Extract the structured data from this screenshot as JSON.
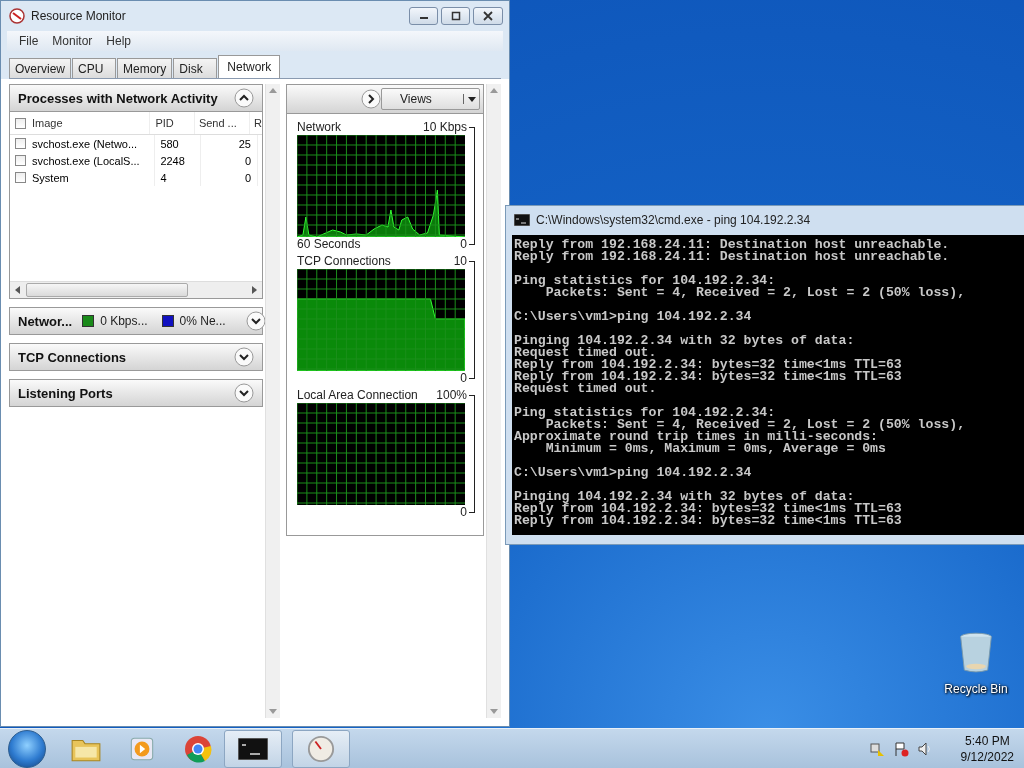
{
  "resource_monitor": {
    "title": "Resource Monitor",
    "menu": [
      "File",
      "Monitor",
      "Help"
    ],
    "tabs": [
      {
        "label": "Overview",
        "selected": false
      },
      {
        "label": "CPU",
        "selected": false
      },
      {
        "label": "Memory",
        "selected": false
      },
      {
        "label": "Disk",
        "selected": false
      },
      {
        "label": "Network",
        "selected": true
      }
    ],
    "processes_panel": {
      "title": "Processes with Network Activity",
      "expanded": true,
      "all_checked": false,
      "columns": [
        "Image",
        "PID",
        "Send ...",
        "R"
      ],
      "rows": [
        {
          "image": "svchost.exe (Netwo...",
          "pid": "580",
          "send": "25",
          "checked": false
        },
        {
          "image": "svchost.exe (LocalS...",
          "pid": "2248",
          "send": "0",
          "checked": false
        },
        {
          "image": "System",
          "pid": "4",
          "send": "0",
          "checked": false
        }
      ]
    },
    "collapsed_panels": [
      {
        "title": "Networ...",
        "expanded": false,
        "legend": [
          {
            "text": "0 Kbps...",
            "color": "#1a8a1a"
          },
          {
            "text": "0% Ne...",
            "color": "#1010c0"
          }
        ]
      },
      {
        "title": "TCP Connections",
        "expanded": false
      },
      {
        "title": "Listening Ports",
        "expanded": false
      }
    ],
    "graphs_panel": {
      "views_button": "Views",
      "graphs": [
        {
          "kind": "spiky",
          "title": "Network",
          "max": "10 Kbps",
          "footer": "60 Seconds",
          "min": "0"
        },
        {
          "kind": "filled",
          "title": "TCP Connections",
          "max": "10",
          "min": "0"
        },
        {
          "kind": "empty",
          "title": "Local Area Connection",
          "max": "100%",
          "min": "0"
        }
      ]
    }
  },
  "cmd": {
    "title": "C:\\Windows\\system32\\cmd.exe - ping  104.192.2.34",
    "blocks": [
      [
        "Reply from 192.168.24.11: Destination host unreachable.",
        "Reply from 192.168.24.11: Destination host unreachable."
      ],
      [
        "Ping statistics for 104.192.2.34:",
        "    Packets: Sent = 4, Received = 2, Lost = 2 (50% loss),"
      ],
      [
        "C:\\Users\\vm1>ping 104.192.2.34"
      ],
      [
        "Pinging 104.192.2.34 with 32 bytes of data:",
        "Request timed out.",
        "Reply from 104.192.2.34: bytes=32 time<1ms TTL=63",
        "Reply from 104.192.2.34: bytes=32 time<1ms TTL=63",
        "Request timed out."
      ],
      [
        "Ping statistics for 104.192.2.34:",
        "    Packets: Sent = 4, Received = 2, Lost = 2 (50% loss),",
        "Approximate round trip times in milli-seconds:",
        "    Minimum = 0ms, Maximum = 0ms, Average = 0ms"
      ],
      [
        "C:\\Users\\vm1>ping 104.192.2.34"
      ],
      [
        "Pinging 104.192.2.34 with 32 bytes of data:",
        "Reply from 104.192.2.34: bytes=32 time<1ms TTL=63",
        "Reply from 104.192.2.34: bytes=32 time<1ms TTL=63"
      ]
    ]
  },
  "desktop_icons": [
    {
      "label": "Recycle Bin"
    }
  ],
  "taskbar": {
    "time": "5:40 PM",
    "date": "9/12/2022"
  }
}
